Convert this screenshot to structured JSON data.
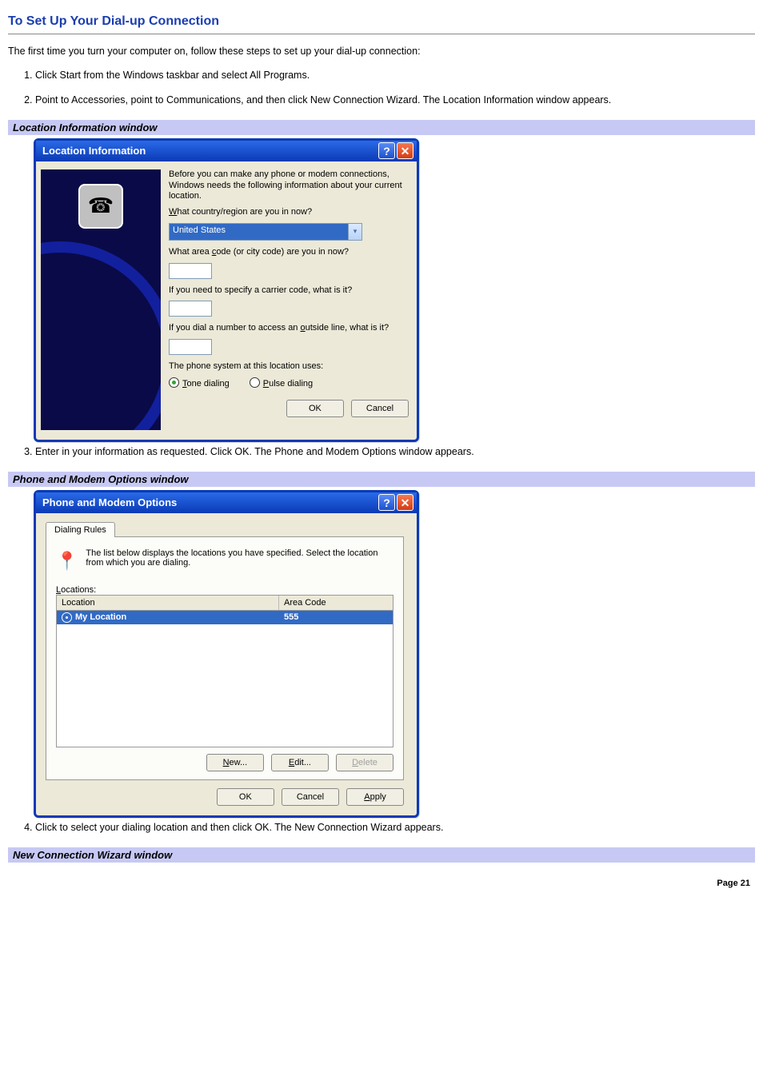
{
  "heading": "To Set Up Your Dial-up Connection",
  "intro": "The first time you turn your computer on, follow these steps to set up your dial-up connection:",
  "steps": [
    "Click Start from the Windows taskbar and select All Programs.",
    "Point to Accessories, point to Communications, and then click New Connection Wizard. The Location Information window appears.",
    "Enter in your information as requested. Click OK. The Phone and Modem Options window appears.",
    "Click to select your dialing location and then click OK. The New Connection Wizard appears."
  ],
  "captions": {
    "location": "Location Information window",
    "pmo": "Phone and Modem Options window",
    "wizard": "New Connection Wizard window"
  },
  "locationDialog": {
    "title": "Location Information",
    "desc": "Before you can make any phone or modem connections, Windows needs the following information about your current location.",
    "q_country": "What country/region are you in now?",
    "country_value": "United States",
    "q_area": "What area code (or city code) are you in now?",
    "q_carrier": "If you need to specify a carrier code, what is it?",
    "q_outside": "If you dial a number to access an outside line, what is it?",
    "q_phonesys": "The phone system at this location uses:",
    "radio_tone": "Tone dialing",
    "radio_pulse": "Pulse dialing",
    "ok": "OK",
    "cancel": "Cancel"
  },
  "pmoDialog": {
    "title": "Phone and Modem Options",
    "tab": "Dialing Rules",
    "desc": "The list below displays the locations you have specified. Select the location from which you are dialing.",
    "locations_label": "Locations:",
    "col_location": "Location",
    "col_area": "Area Code",
    "row_location": "My Location",
    "row_area": "555",
    "btn_new": "New...",
    "btn_edit": "Edit...",
    "btn_delete": "Delete",
    "ok": "OK",
    "cancel": "Cancel",
    "apply": "Apply"
  },
  "pageNumber": "Page 21"
}
